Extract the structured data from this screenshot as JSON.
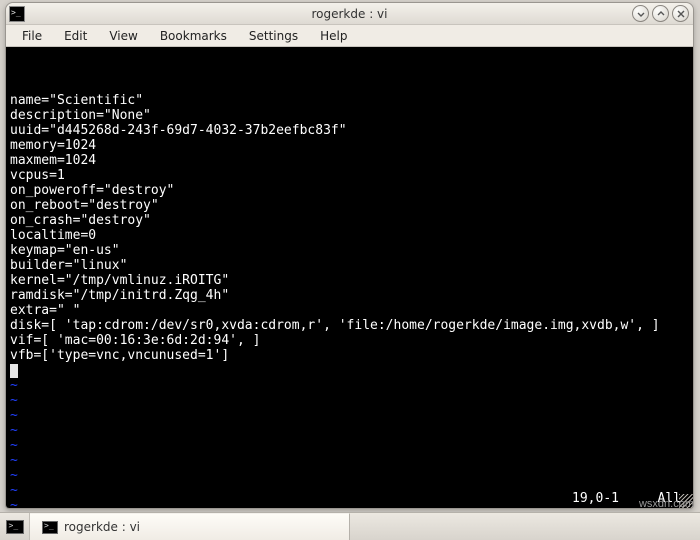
{
  "window": {
    "title": "rogerkde : vi"
  },
  "menubar": {
    "file": "File",
    "edit": "Edit",
    "view": "View",
    "bookmarks": "Bookmarks",
    "settings": "Settings",
    "help": "Help"
  },
  "terminal": {
    "lines": [
      "name=\"Scientific\"",
      "description=\"None\"",
      "uuid=\"d445268d-243f-69d7-4032-37b2eefbc83f\"",
      "memory=1024",
      "maxmem=1024",
      "vcpus=1",
      "on_poweroff=\"destroy\"",
      "on_reboot=\"destroy\"",
      "on_crash=\"destroy\"",
      "localtime=0",
      "keymap=\"en-us\"",
      "builder=\"linux\"",
      "kernel=\"/tmp/vmlinuz.iROITG\"",
      "ramdisk=\"/tmp/initrd.Zqg_4h\"",
      "extra=\" \"",
      "disk=[ 'tap:cdrom:/dev/sr0,xvda:cdrom,r', 'file:/home/rogerkde/image.img,xvdb,w', ]",
      "vif=[ 'mac=00:16:3e:6d:2d:94', ]",
      "vfb=['type=vnc,vncunused=1']"
    ],
    "tilde_count": 10,
    "status_position": "19,0-1",
    "status_scroll": "All"
  },
  "taskbar": {
    "active_task": "rogerkde : vi"
  },
  "watermark": "wsxdn.com"
}
